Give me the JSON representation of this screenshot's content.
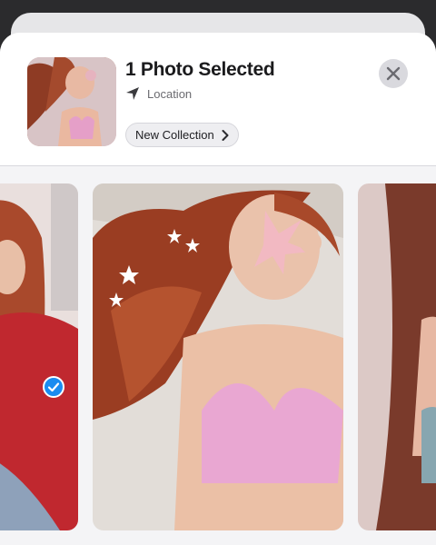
{
  "sheet": {
    "title": "1 Photo Selected",
    "location_label": "Location",
    "collection_button_label": "New Collection"
  },
  "icons": {
    "location": "location-arrow-icon",
    "chevron": "chevron-right-icon",
    "close": "close-x-icon",
    "selected": "checkmark-circle-icon"
  },
  "carousel": {
    "photos": [
      {
        "position": "left",
        "selected": true
      },
      {
        "position": "center",
        "selected": false
      },
      {
        "position": "right",
        "selected": false
      }
    ]
  },
  "colors": {
    "selection_accent": "#1a8cf0",
    "sheet_background": "#f4f4f6",
    "header_background": "#ffffff"
  }
}
